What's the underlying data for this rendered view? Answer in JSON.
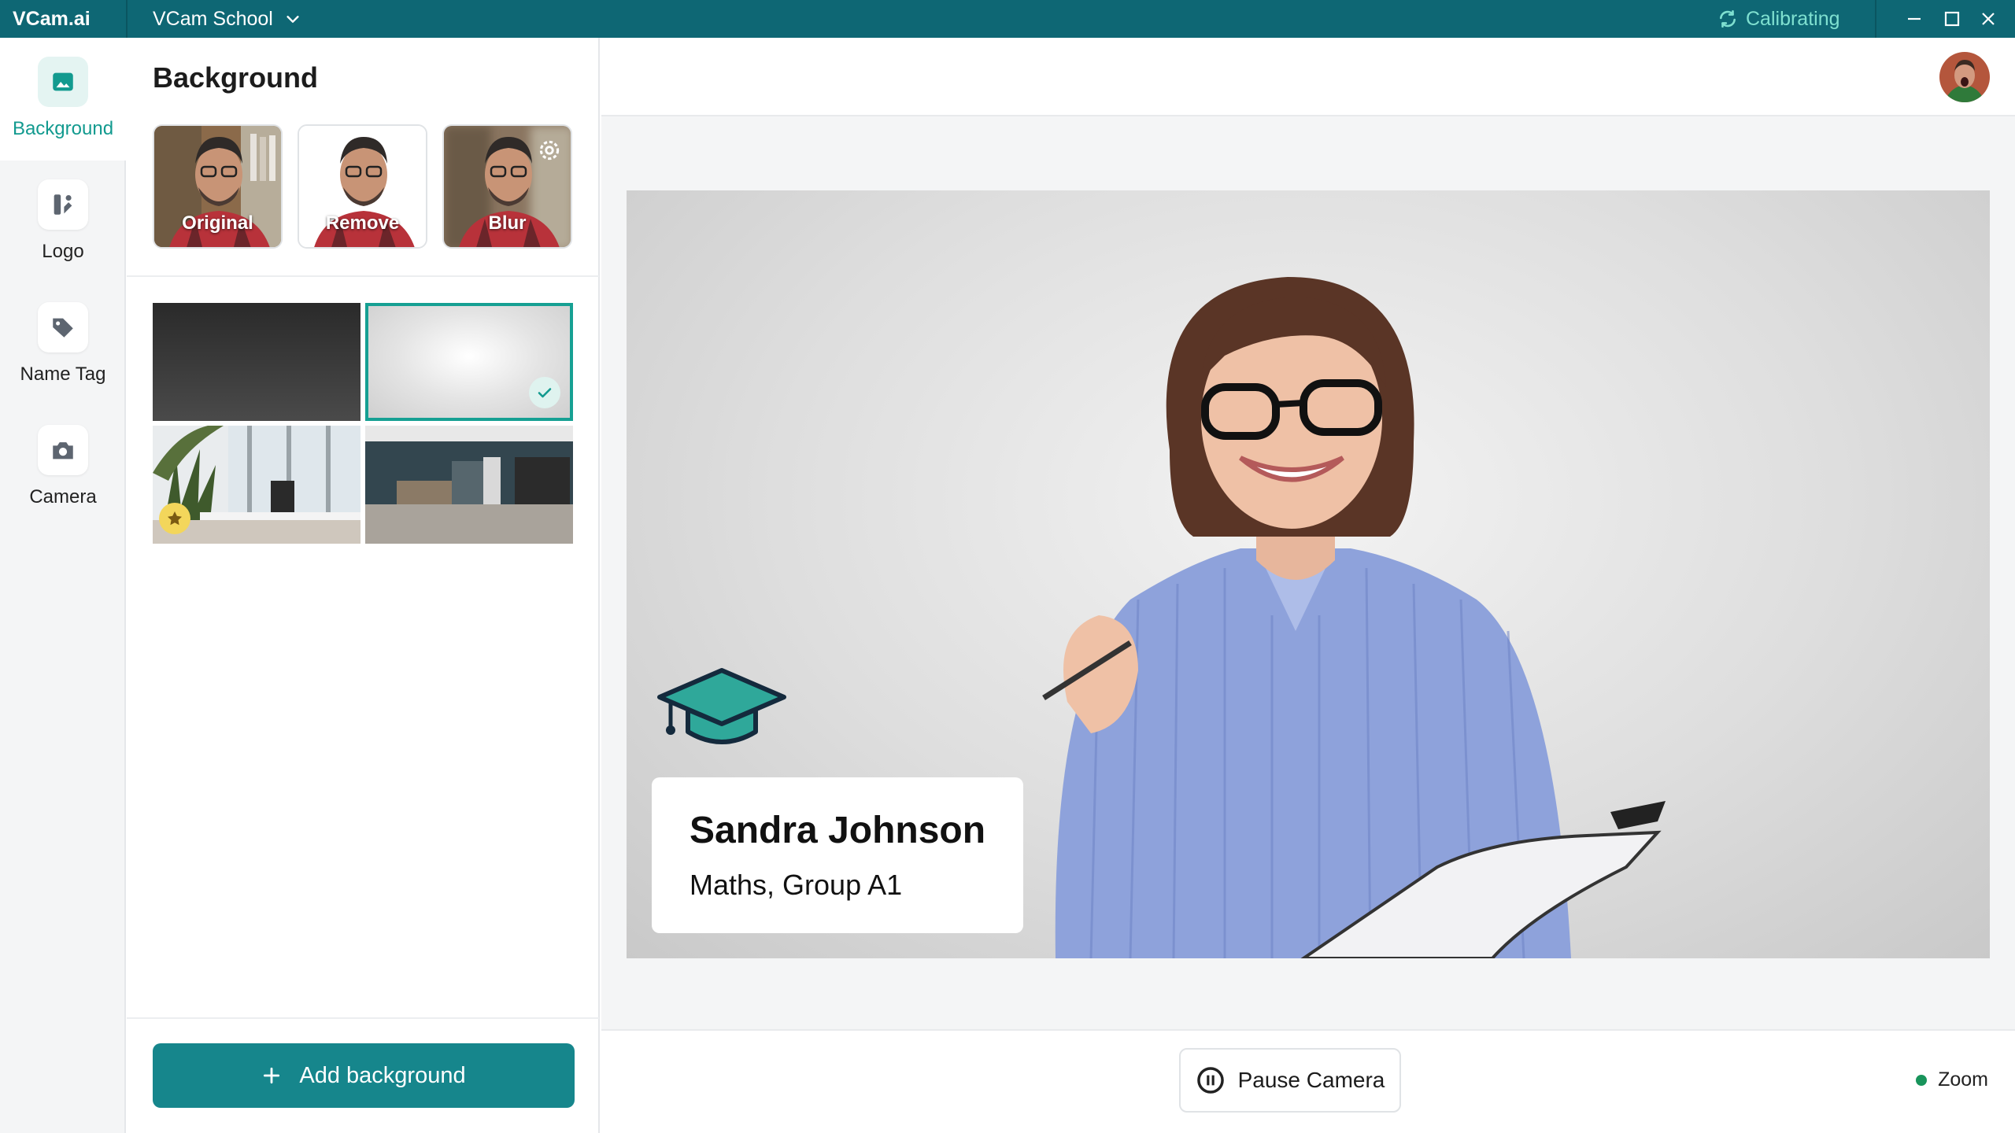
{
  "titlebar": {
    "brand": "VCam.ai",
    "workspace": "VCam School",
    "status": "Calibrating"
  },
  "nav": {
    "items": [
      {
        "label": "Background",
        "icon": "image-icon",
        "active": true
      },
      {
        "label": "Logo",
        "icon": "logo-icon",
        "active": false
      },
      {
        "label": "Name Tag",
        "icon": "tag-icon",
        "active": false
      },
      {
        "label": "Camera",
        "icon": "camera-icon",
        "active": false
      }
    ]
  },
  "panel": {
    "title": "Background",
    "modes": [
      {
        "label": "Original"
      },
      {
        "label": "Remove"
      },
      {
        "label": "Blur"
      }
    ],
    "backgrounds": [
      "dark-gradient",
      "light-gradient",
      "office-plants",
      "office-hallway"
    ],
    "selected_background": 1,
    "add_button": "Add background"
  },
  "preview": {
    "name": "Sandra Johnson",
    "subtitle": "Maths, Group A1"
  },
  "footer": {
    "pause_button": "Pause Camera",
    "output": "Zoom"
  },
  "colors": {
    "titlebar": "#0e6774",
    "accent": "#16a093",
    "button": "#16868c",
    "status_dot": "#18945b",
    "calibrating": "#7fe0d0"
  }
}
